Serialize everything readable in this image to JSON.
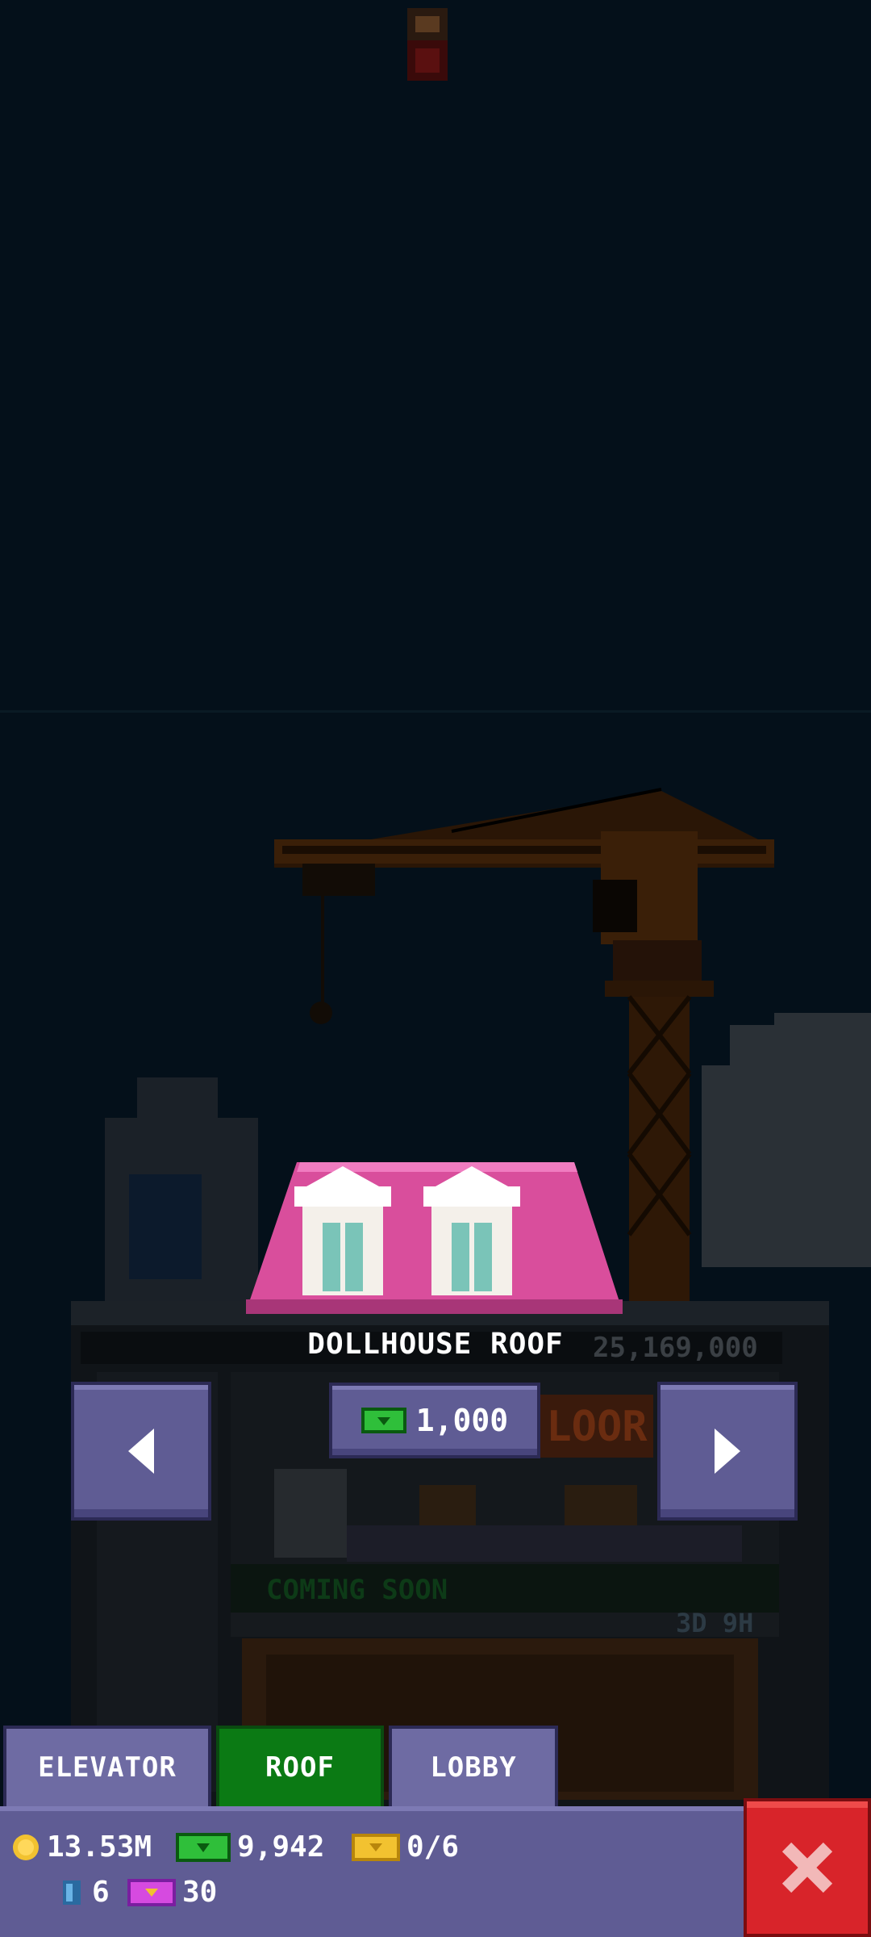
{
  "roof": {
    "name": "DOLLHOUSE ROOF",
    "price": "1,000",
    "tower_value": "25,169,000"
  },
  "background": {
    "coming_soon": "COMING SOON",
    "timer": "3D 9H"
  },
  "tabs": [
    {
      "label": "ELEVATOR",
      "selected": false
    },
    {
      "label": "ROOF",
      "selected": true
    },
    {
      "label": "LOBBY",
      "selected": false
    }
  ],
  "stats": {
    "coins": "13.53M",
    "bux": "9,942",
    "vip_tickets": "0/6",
    "golden_tickets": "6",
    "lucky_tickets": "30"
  },
  "icons": {
    "prev": "arrow-left-icon",
    "next": "arrow-right-icon",
    "close": "close-icon"
  },
  "colors": {
    "background": "#04101a",
    "button": "#5f5c94",
    "selected_tab": "#0b7a14",
    "close": "#d8242a",
    "roof_pink": "#d94e9c"
  }
}
